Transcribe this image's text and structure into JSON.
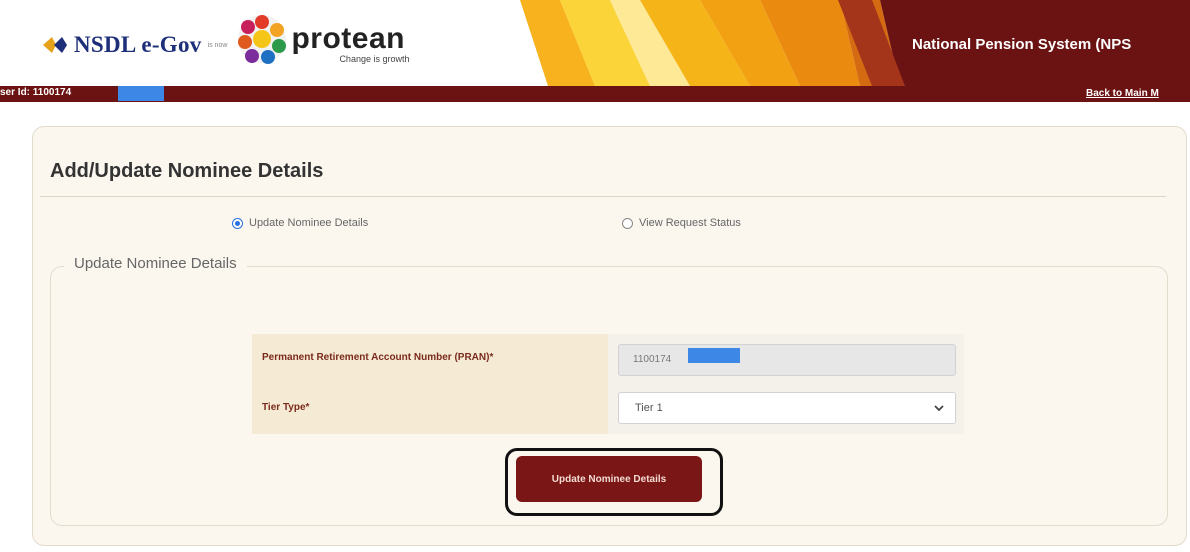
{
  "header": {
    "nsdl_text": "NSDL e-Gov",
    "is_now": "is now",
    "protean_text": "protean",
    "protean_tagline": "Change is growth",
    "system_title": "National Pension System (NPS"
  },
  "userbar": {
    "user_id_label": "ser Id: 1100174",
    "back_link": "Back to Main M"
  },
  "page": {
    "title": "Add/Update Nominee Details",
    "radios": [
      {
        "label": "Update Nominee Details",
        "selected": true
      },
      {
        "label": "View Request Status",
        "selected": false
      }
    ],
    "section_legend": "Update Nominee Details"
  },
  "form": {
    "pran_label": "Permanent Retirement Account Number (PRAN)*",
    "pran_value": "1100174",
    "tier_label": "Tier Type*",
    "tier_value": "Tier 1"
  },
  "actions": {
    "submit_label": "Update Nominee Details"
  },
  "colors": {
    "brand_maroon": "#6b1212",
    "button": "#7b1616",
    "mask_blue": "#3d87e6",
    "panel_bg": "#fbf7ef",
    "label": "#7a2a1c"
  },
  "icons": [
    "nsdl-logo-icon",
    "protean-logo-icon",
    "radio-icon",
    "chevron-down-icon"
  ]
}
